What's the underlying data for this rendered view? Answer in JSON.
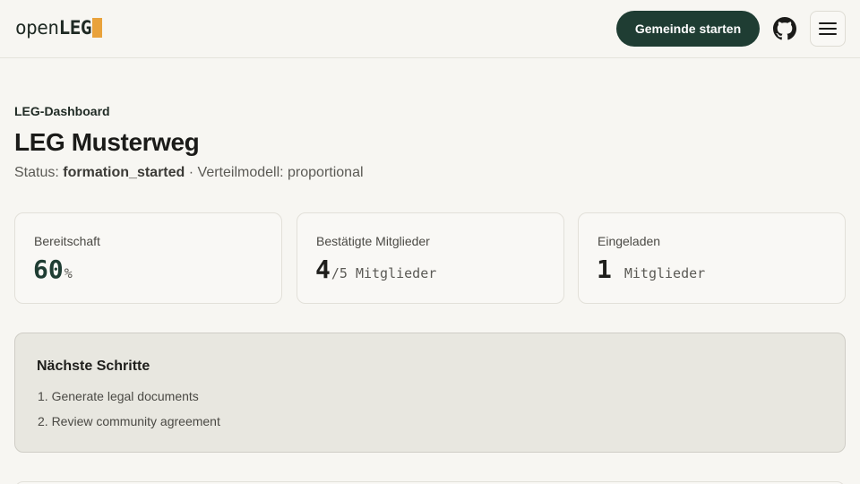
{
  "header": {
    "logo_prefix": "open",
    "logo_suffix": "LEG",
    "brand_color": "#e9a23b",
    "start_button": "Gemeinde starten",
    "github_icon": "github-icon",
    "menu_icon": "hamburger-menu-icon"
  },
  "page": {
    "eyebrow": "LEG-Dashboard",
    "title": "LEG Musterweg",
    "status_label": "Status:",
    "status_value": "formation_started",
    "separator": "·",
    "model_label": "Verteilmodell:",
    "model_value": "proportional"
  },
  "stats": {
    "readiness": {
      "label": "Bereitschaft",
      "value": "60",
      "unit": "%"
    },
    "confirmed": {
      "label": "Bestätigte Mitglieder",
      "value": "4",
      "unit": "/5 Mitglieder"
    },
    "invited": {
      "label": "Eingeladen",
      "value": "1",
      "unit": "Mitglieder"
    }
  },
  "next_steps": {
    "heading": "Nächste Schritte",
    "items": [
      "1. Generate legal documents",
      "2. Review community agreement"
    ]
  },
  "colors": {
    "accent": "#1f3d33",
    "background": "#f7f6f2",
    "panel": "#e8e7e0"
  }
}
